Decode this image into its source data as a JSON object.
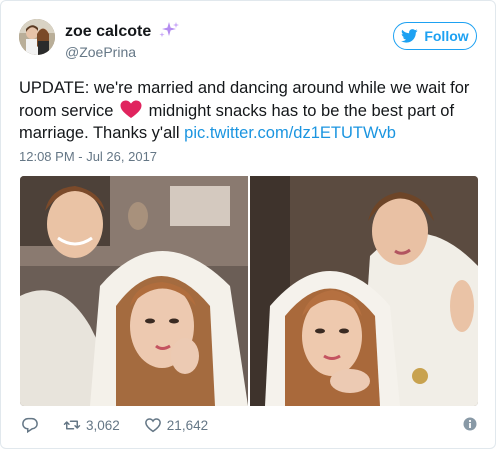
{
  "author": {
    "display_name": "zoe calcote",
    "handle": "@ZoePrina",
    "avatar": "avatar-photo",
    "name_emoji": "sparkles-icon"
  },
  "follow_button": {
    "label": "Follow",
    "icon": "twitter-bird-icon",
    "color": "#1da1f2"
  },
  "tweet": {
    "text_line1": "UPDATE: we're married and dancing around while we wait for",
    "text_line2_a": "room service",
    "heart_emoji": "red-heart-icon",
    "text_line2_b": "midnight snacks has to be the best part of",
    "text_line3": "marriage. Thanks y'all",
    "link": "pic.twitter.com/dz1ETUTWvb",
    "timestamp": "12:08 PM - Jul 26, 2017"
  },
  "media": {
    "photos": [
      "couple-photo-left",
      "couple-photo-right"
    ]
  },
  "actions": {
    "reply_icon": "reply-icon",
    "retweet_icon": "retweet-icon",
    "retweet_count": "3,062",
    "like_icon": "heart-outline-icon",
    "like_count": "21,642",
    "info_icon": "info-icon"
  },
  "colors": {
    "link": "#1b95e0",
    "secondary_text": "#657786",
    "heart_emoji": "#e0245e"
  }
}
